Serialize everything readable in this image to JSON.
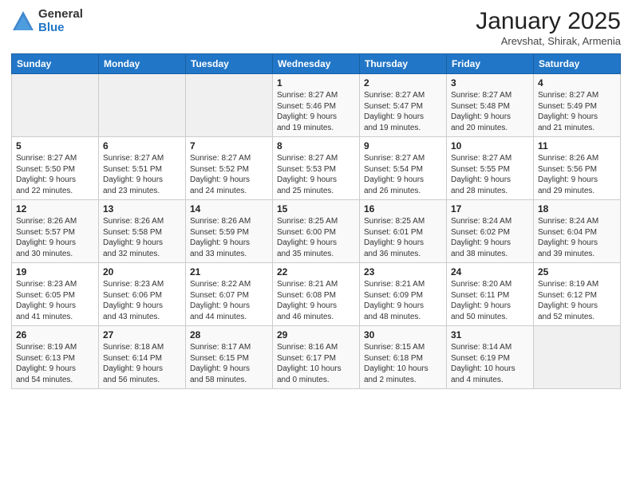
{
  "logo": {
    "general": "General",
    "blue": "Blue"
  },
  "header": {
    "title": "January 2025",
    "subtitle": "Arevshat, Shirak, Armenia"
  },
  "weekdays": [
    "Sunday",
    "Monday",
    "Tuesday",
    "Wednesday",
    "Thursday",
    "Friday",
    "Saturday"
  ],
  "weeks": [
    [
      {
        "day": "",
        "info": ""
      },
      {
        "day": "",
        "info": ""
      },
      {
        "day": "",
        "info": ""
      },
      {
        "day": "1",
        "info": "Sunrise: 8:27 AM\nSunset: 5:46 PM\nDaylight: 9 hours\nand 19 minutes."
      },
      {
        "day": "2",
        "info": "Sunrise: 8:27 AM\nSunset: 5:47 PM\nDaylight: 9 hours\nand 19 minutes."
      },
      {
        "day": "3",
        "info": "Sunrise: 8:27 AM\nSunset: 5:48 PM\nDaylight: 9 hours\nand 20 minutes."
      },
      {
        "day": "4",
        "info": "Sunrise: 8:27 AM\nSunset: 5:49 PM\nDaylight: 9 hours\nand 21 minutes."
      }
    ],
    [
      {
        "day": "5",
        "info": "Sunrise: 8:27 AM\nSunset: 5:50 PM\nDaylight: 9 hours\nand 22 minutes."
      },
      {
        "day": "6",
        "info": "Sunrise: 8:27 AM\nSunset: 5:51 PM\nDaylight: 9 hours\nand 23 minutes."
      },
      {
        "day": "7",
        "info": "Sunrise: 8:27 AM\nSunset: 5:52 PM\nDaylight: 9 hours\nand 24 minutes."
      },
      {
        "day": "8",
        "info": "Sunrise: 8:27 AM\nSunset: 5:53 PM\nDaylight: 9 hours\nand 25 minutes."
      },
      {
        "day": "9",
        "info": "Sunrise: 8:27 AM\nSunset: 5:54 PM\nDaylight: 9 hours\nand 26 minutes."
      },
      {
        "day": "10",
        "info": "Sunrise: 8:27 AM\nSunset: 5:55 PM\nDaylight: 9 hours\nand 28 minutes."
      },
      {
        "day": "11",
        "info": "Sunrise: 8:26 AM\nSunset: 5:56 PM\nDaylight: 9 hours\nand 29 minutes."
      }
    ],
    [
      {
        "day": "12",
        "info": "Sunrise: 8:26 AM\nSunset: 5:57 PM\nDaylight: 9 hours\nand 30 minutes."
      },
      {
        "day": "13",
        "info": "Sunrise: 8:26 AM\nSunset: 5:58 PM\nDaylight: 9 hours\nand 32 minutes."
      },
      {
        "day": "14",
        "info": "Sunrise: 8:26 AM\nSunset: 5:59 PM\nDaylight: 9 hours\nand 33 minutes."
      },
      {
        "day": "15",
        "info": "Sunrise: 8:25 AM\nSunset: 6:00 PM\nDaylight: 9 hours\nand 35 minutes."
      },
      {
        "day": "16",
        "info": "Sunrise: 8:25 AM\nSunset: 6:01 PM\nDaylight: 9 hours\nand 36 minutes."
      },
      {
        "day": "17",
        "info": "Sunrise: 8:24 AM\nSunset: 6:02 PM\nDaylight: 9 hours\nand 38 minutes."
      },
      {
        "day": "18",
        "info": "Sunrise: 8:24 AM\nSunset: 6:04 PM\nDaylight: 9 hours\nand 39 minutes."
      }
    ],
    [
      {
        "day": "19",
        "info": "Sunrise: 8:23 AM\nSunset: 6:05 PM\nDaylight: 9 hours\nand 41 minutes."
      },
      {
        "day": "20",
        "info": "Sunrise: 8:23 AM\nSunset: 6:06 PM\nDaylight: 9 hours\nand 43 minutes."
      },
      {
        "day": "21",
        "info": "Sunrise: 8:22 AM\nSunset: 6:07 PM\nDaylight: 9 hours\nand 44 minutes."
      },
      {
        "day": "22",
        "info": "Sunrise: 8:21 AM\nSunset: 6:08 PM\nDaylight: 9 hours\nand 46 minutes."
      },
      {
        "day": "23",
        "info": "Sunrise: 8:21 AM\nSunset: 6:09 PM\nDaylight: 9 hours\nand 48 minutes."
      },
      {
        "day": "24",
        "info": "Sunrise: 8:20 AM\nSunset: 6:11 PM\nDaylight: 9 hours\nand 50 minutes."
      },
      {
        "day": "25",
        "info": "Sunrise: 8:19 AM\nSunset: 6:12 PM\nDaylight: 9 hours\nand 52 minutes."
      }
    ],
    [
      {
        "day": "26",
        "info": "Sunrise: 8:19 AM\nSunset: 6:13 PM\nDaylight: 9 hours\nand 54 minutes."
      },
      {
        "day": "27",
        "info": "Sunrise: 8:18 AM\nSunset: 6:14 PM\nDaylight: 9 hours\nand 56 minutes."
      },
      {
        "day": "28",
        "info": "Sunrise: 8:17 AM\nSunset: 6:15 PM\nDaylight: 9 hours\nand 58 minutes."
      },
      {
        "day": "29",
        "info": "Sunrise: 8:16 AM\nSunset: 6:17 PM\nDaylight: 10 hours\nand 0 minutes."
      },
      {
        "day": "30",
        "info": "Sunrise: 8:15 AM\nSunset: 6:18 PM\nDaylight: 10 hours\nand 2 minutes."
      },
      {
        "day": "31",
        "info": "Sunrise: 8:14 AM\nSunset: 6:19 PM\nDaylight: 10 hours\nand 4 minutes."
      },
      {
        "day": "",
        "info": ""
      }
    ]
  ]
}
